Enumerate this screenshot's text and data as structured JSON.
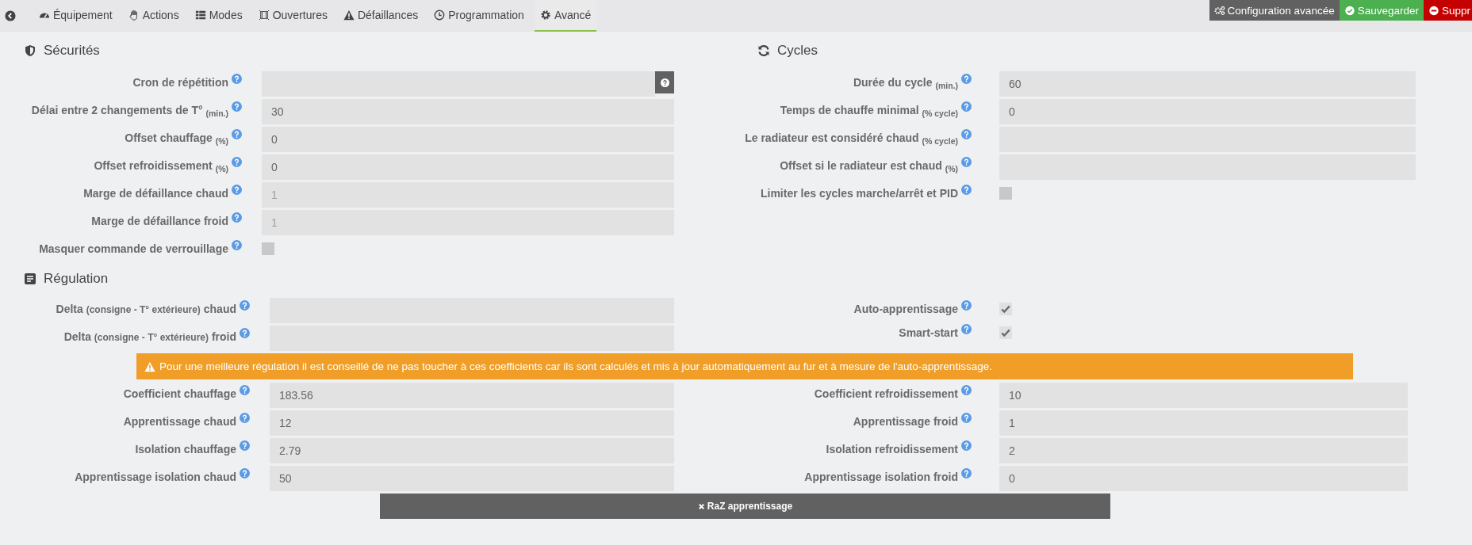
{
  "nav": {
    "tabs": [
      {
        "label": "Équipement",
        "selected": false
      },
      {
        "label": "Actions",
        "selected": false
      },
      {
        "label": "Modes",
        "selected": false
      },
      {
        "label": "Ouvertures",
        "selected": false
      },
      {
        "label": "Défaillances",
        "selected": false
      },
      {
        "label": "Programmation",
        "selected": false
      },
      {
        "label": "Avancé",
        "selected": true
      }
    ],
    "buttons": [
      {
        "label": "Configuration avancée",
        "kind": "neutral"
      },
      {
        "label": "Sauvegarder",
        "kind": "success"
      },
      {
        "label": "Suppr",
        "kind": "danger"
      }
    ]
  },
  "securites": {
    "title": "Sécurités",
    "fields": [
      {
        "label": [
          {
            "text": "Cron de répétition",
            "kind": "text"
          }
        ],
        "kind": "cron"
      },
      {
        "label": [
          {
            "text": "Délai entre 2 changements de T° ",
            "kind": "text"
          },
          {
            "text": "(min.)",
            "kind": "unit"
          }
        ],
        "kind": "input",
        "value": "30"
      },
      {
        "label": [
          {
            "text": "Offset chauffage ",
            "kind": "text"
          },
          {
            "text": "(%)",
            "kind": "unit"
          }
        ],
        "kind": "input",
        "value": "0"
      },
      {
        "label": [
          {
            "text": "Offset refroidissement ",
            "kind": "text"
          },
          {
            "text": "(%)",
            "kind": "unit"
          }
        ],
        "kind": "input",
        "value": "0"
      },
      {
        "label": [
          {
            "text": "Marge de défaillance chaud",
            "kind": "text"
          }
        ],
        "kind": "input",
        "placeholder": "1"
      },
      {
        "label": [
          {
            "text": "Marge de défaillance froid",
            "kind": "text"
          }
        ],
        "kind": "input",
        "placeholder": "1"
      },
      {
        "label": [
          {
            "text": "Masquer commande de verrouillage",
            "kind": "text"
          }
        ],
        "kind": "checkbox",
        "checked": false
      }
    ]
  },
  "cycles": {
    "title": "Cycles",
    "fields": [
      {
        "label": [
          {
            "text": "Durée du cycle ",
            "kind": "text"
          },
          {
            "text": "(min.)",
            "kind": "unit"
          }
        ],
        "kind": "input",
        "value": "60"
      },
      {
        "label": [
          {
            "text": "Temps de chauffe minimal ",
            "kind": "text"
          },
          {
            "text": "(% cycle)",
            "kind": "unit"
          }
        ],
        "kind": "input",
        "value": "0"
      },
      {
        "label": [
          {
            "text": "Le radiateur est considéré chaud ",
            "kind": "text"
          },
          {
            "text": "(% cycle)",
            "kind": "unit"
          }
        ],
        "kind": "input"
      },
      {
        "label": [
          {
            "text": "Offset si le radiateur est chaud ",
            "kind": "text"
          },
          {
            "text": "(%)",
            "kind": "unit"
          }
        ],
        "kind": "input"
      },
      {
        "label": [
          {
            "text": "Limiter les cycles marche/arrêt et PID",
            "kind": "text"
          }
        ],
        "kind": "checkbox",
        "checked": false
      }
    ]
  },
  "regulation": {
    "title": "Régulation",
    "left_fields": [
      {
        "label": [
          {
            "text": "Delta ",
            "kind": "text"
          },
          {
            "text": "(consigne - T° extérieure)",
            "kind": "note"
          },
          {
            "text": " chaud",
            "kind": "text"
          }
        ],
        "kind": "input"
      },
      {
        "label": [
          {
            "text": "Delta ",
            "kind": "text"
          },
          {
            "text": "(consigne - T° extérieure)",
            "kind": "note"
          },
          {
            "text": " froid",
            "kind": "text"
          }
        ],
        "kind": "input"
      }
    ],
    "right_fields": [
      {
        "label": [
          {
            "text": "Auto-apprentissage",
            "kind": "text"
          }
        ],
        "kind": "checkbox",
        "checked": true
      },
      {
        "label": [
          {
            "text": "Smart-start",
            "kind": "text"
          }
        ],
        "kind": "checkbox",
        "checked": true
      }
    ],
    "warning": "Pour une meilleure régulation il est conseillé de ne pas toucher à ces coefficients car ils sont calculés et mis à jour automatiquement au fur et à mesure de l'auto-apprentissage.",
    "left_coefficients": [
      {
        "label": [
          {
            "text": "Coefficient chauffage",
            "kind": "text"
          }
        ],
        "kind": "input",
        "value": "183.56"
      },
      {
        "label": [
          {
            "text": "Apprentissage chaud",
            "kind": "text"
          }
        ],
        "kind": "input",
        "value": "12"
      },
      {
        "label": [
          {
            "text": "Isolation chauffage",
            "kind": "text"
          }
        ],
        "kind": "input",
        "value": "2.79"
      },
      {
        "label": [
          {
            "text": "Apprentissage isolation chaud",
            "kind": "text"
          }
        ],
        "kind": "input",
        "value": "50"
      }
    ],
    "right_coefficients": [
      {
        "label": [
          {
            "text": "Coefficient refroidissement",
            "kind": "text"
          }
        ],
        "kind": "input",
        "value": "10"
      },
      {
        "label": [
          {
            "text": "Apprentissage froid",
            "kind": "text"
          }
        ],
        "kind": "input",
        "value": "1"
      },
      {
        "label": [
          {
            "text": "Isolation refroidissement",
            "kind": "text"
          }
        ],
        "kind": "input",
        "value": "2"
      },
      {
        "label": [
          {
            "text": "Apprentissage isolation froid",
            "kind": "text"
          }
        ],
        "kind": "input",
        "value": "0"
      }
    ],
    "reset_button": "RaZ apprentissage"
  }
}
